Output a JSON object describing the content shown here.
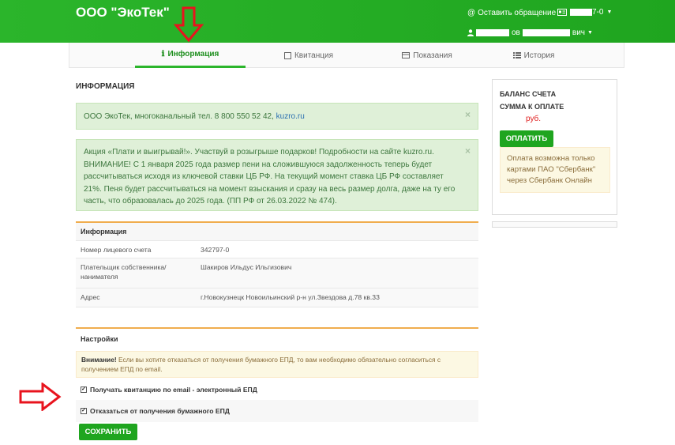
{
  "header": {
    "brand": "ООО \"ЭкоТек\"",
    "appeal_label": "Оставить обращение",
    "account_number": "7-0",
    "user_name_part": "ов",
    "user_name_end": "вич"
  },
  "tabs": [
    {
      "label": "Информация",
      "icon": "info-icon",
      "active": true
    },
    {
      "label": "Квитанция",
      "icon": "receipt-icon",
      "active": false
    },
    {
      "label": "Показания",
      "icon": "meter-icon",
      "active": false
    },
    {
      "label": "История",
      "icon": "list-icon",
      "active": false
    }
  ],
  "page_title": "ИНФОРМАЦИЯ",
  "alert_contact": {
    "text": "ООО ЭкоТек, многоканальный тел. 8 800 550 52 42, ",
    "link": "kuzro.ru",
    "close": "×"
  },
  "alert_promo": {
    "text": "Акция «Плати и выигрывай!». Участвуй в розыгрыше подарков! Подробности на сайте kuzro.ru. ВНИМАНИЕ! С 1 января 2025 года размер пени на сложившуюся задолженность теперь будет рассчитываться исходя из ключевой ставки ЦБ РФ. На текущий момент ставка ЦБ РФ составляет 21%. Пеня будет рассчитываться на момент взыскания и сразу на весь размер долга, даже на ту его часть, что образовалась до 2025 года. (ПП РФ от 26.03.2022 № 474).",
    "close": "×"
  },
  "info_panel": {
    "title": "Информация",
    "rows": [
      {
        "label": "Номер лицевого счета",
        "value": "342797-0"
      },
      {
        "label": "Плательщик собственника/ нанимателя",
        "value": "Шакиров Ильдус Ильгизович"
      },
      {
        "label": "Адрес",
        "value": "г.Новокузнецк Новоильинский р-н ул.Звездова д.78 кв.33"
      }
    ]
  },
  "settings_panel": {
    "title": "Настройки",
    "warning_bold": "Внимание!",
    "warning_text": " Если вы хотите отказаться от получения бумажного ЕПД, то вам необходимо обязательно согласиться с получением ЕПД по email.",
    "option_email": "Получать квитанцию по email - электронный ЕПД",
    "option_email_checked": true,
    "option_paper": "Отказаться от получения бумажного ЕПД",
    "option_paper_checked": true,
    "save_label": "СОХРАНИТЬ"
  },
  "sidebar": {
    "balance_label": "БАЛАНС СЧЕТА",
    "sum_label": "СУММА К ОПЛАТЕ",
    "currency": "руб.",
    "pay_label": "ОПЛАТИТЬ",
    "note": "Оплата возможна только картами ПАО \"Сбербанк\" через Сбербанк Онлайн"
  },
  "colors": {
    "brand_green": "#1fa51f",
    "annotation_red": "#e8141e",
    "alert_green": "#dff0d8",
    "warn_yellow": "#fcf8e3"
  }
}
